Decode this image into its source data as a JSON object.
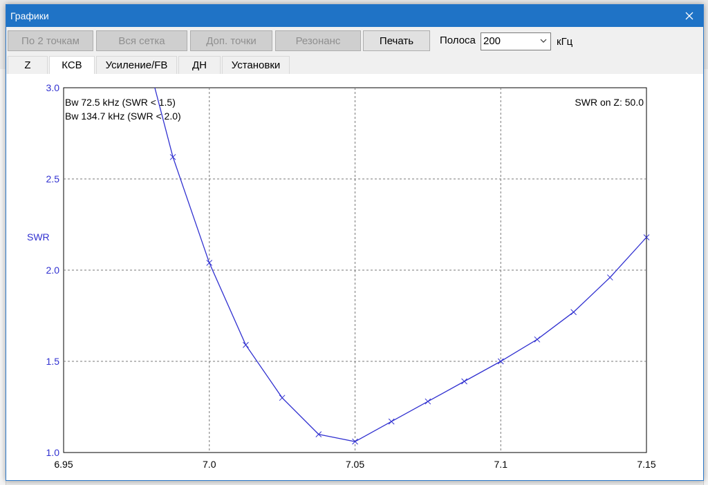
{
  "window": {
    "title": "Графики"
  },
  "toolbar": {
    "buttons": [
      {
        "label": "По 2 точкам",
        "enabled": false
      },
      {
        "label": "Вся сетка",
        "enabled": false
      },
      {
        "label": "Доп. точки",
        "enabled": false
      },
      {
        "label": "Резонанс",
        "enabled": false
      },
      {
        "label": "Печать",
        "enabled": true
      }
    ],
    "band_label": "Полоса",
    "band_value": "200",
    "band_unit": "кГц"
  },
  "tabs": [
    {
      "label": "Z",
      "active": false
    },
    {
      "label": "КСВ",
      "active": true
    },
    {
      "label": "Усиление/FB",
      "active": false
    },
    {
      "label": "ДН",
      "active": false
    },
    {
      "label": "Установки",
      "active": false
    }
  ],
  "chart_data": {
    "type": "line",
    "ylabel": "SWR",
    "xlabel": "",
    "xlim": [
      6.95,
      7.15
    ],
    "ylim": [
      1.0,
      3.0
    ],
    "x_ticks": [
      "6.95",
      "7.0",
      "7.05",
      "7.1",
      "7.15"
    ],
    "y_ticks": [
      "1.0",
      "1.5",
      "2.0",
      "2.5",
      "3.0"
    ],
    "grid": true,
    "annotations": [
      "Bw 72.5 kHz (SWR < 1.5)",
      "Bw 134.7 kHz (SWR < 2.0)"
    ],
    "corner_note": "SWR on Z: 50.0",
    "colors": {
      "line": "#3030d0",
      "ylabel": "#3030d0"
    },
    "series": [
      {
        "x": [
          6.9813,
          6.9875,
          7.0,
          7.0125,
          7.025,
          7.0375,
          7.05,
          7.0625,
          7.075,
          7.0875,
          7.1,
          7.1125,
          7.125,
          7.1375,
          7.15
        ],
        "y": [
          3.0,
          2.62,
          2.04,
          1.59,
          1.3,
          1.1,
          1.06,
          1.17,
          1.28,
          1.39,
          1.5,
          1.62,
          1.77,
          1.96,
          2.18
        ],
        "markers": [
          false,
          true,
          true,
          true,
          true,
          true,
          true,
          true,
          true,
          true,
          true,
          true,
          true,
          true,
          true
        ]
      }
    ]
  }
}
